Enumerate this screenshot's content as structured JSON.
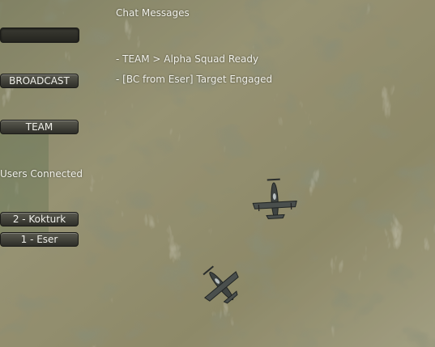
{
  "chat": {
    "title": "Chat Messages",
    "input_value": "",
    "messages": [
      "- TEAM > Alpha Squad Ready",
      "- [BC from Eser] Target Engaged"
    ]
  },
  "controls": {
    "broadcast_label": "BROADCAST",
    "team_label": "TEAM"
  },
  "users": {
    "title": "Users Connected",
    "list": [
      "2 - Kokturk",
      "1 - Eser"
    ]
  },
  "colors": {
    "terrain": "#8d8a68",
    "button": "#3c3c34",
    "text": "#f2f2ea"
  },
  "icons": [
    "fighter-plane-icon"
  ]
}
